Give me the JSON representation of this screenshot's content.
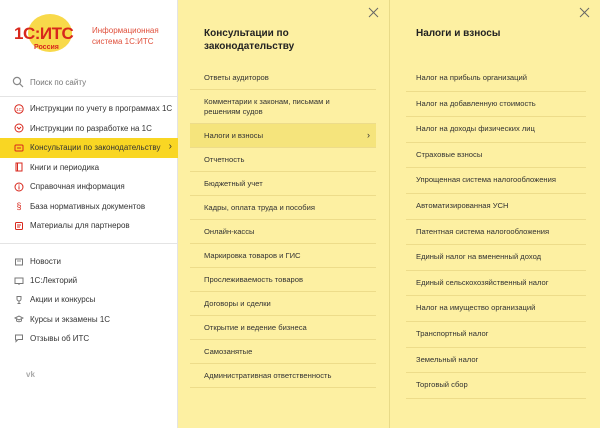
{
  "logo": {
    "brand": "1С:ИТС",
    "sub": "Россия",
    "tagline": "Информационная система 1С:ИТС"
  },
  "search": {
    "placeholder": "Поиск по сайту"
  },
  "nav_main": [
    {
      "label": "Инструкции по учету в программах 1С",
      "icon": "itc-badge-icon"
    },
    {
      "label": "Инструкции по разработке на 1С",
      "icon": "developer-icon"
    },
    {
      "label": "Консультации по законодательству",
      "icon": "consultation-icon",
      "active": true
    },
    {
      "label": "Книги и периодика",
      "icon": "book-icon"
    },
    {
      "label": "Справочная информация",
      "icon": "info-icon"
    },
    {
      "label": "База нормативных документов",
      "icon": "paragraph-icon"
    },
    {
      "label": "Материалы для партнеров",
      "icon": "partner-icon"
    }
  ],
  "nav_secondary": [
    {
      "label": "Новости",
      "icon": "news-icon"
    },
    {
      "label": "1С:Лекторий",
      "icon": "lecture-icon"
    },
    {
      "label": "Акции и конкурсы",
      "icon": "trophy-icon"
    },
    {
      "label": "Курсы и экзамены 1С",
      "icon": "graduation-icon"
    },
    {
      "label": "Отзывы об ИТС",
      "icon": "chat-icon"
    }
  ],
  "social": {
    "vk": "vk"
  },
  "middle_panel": {
    "title": "Консультации по законодательству",
    "items": [
      "Ответы аудиторов",
      "Комментарии к законам, письмам и решениям судов",
      "Налоги и взносы",
      "Отчетность",
      "Бюджетный учет",
      "Кадры, оплата труда и пособия",
      "Онлайн-кассы",
      "Маркировка товаров и ГИС",
      "Прослеживаемость товаров",
      "Договоры и сделки",
      "Открытие и ведение бизнеса",
      "Самозанятые",
      "Административная ответственность"
    ],
    "active_index": 2
  },
  "right_panel": {
    "title": "Налоги и взносы",
    "items": [
      "Налог на прибыль организаций",
      "Налог на добавленную стоимость",
      "Налог на доходы физических лиц",
      "Страховые взносы",
      "Упрощенная система налогообложения",
      "Автоматизированная УСН",
      "Патентная система налогообложения",
      "Единый налог на вмененный доход",
      "Единый сельскохозяйственный налог",
      "Налог на имущество организаций",
      "Транспортный налог",
      "Земельный налог",
      "Торговый сбор"
    ]
  },
  "colors": {
    "accent": "#f9d623",
    "panel_bg": "#fdf0a2",
    "brand_red": "#d8271c"
  }
}
